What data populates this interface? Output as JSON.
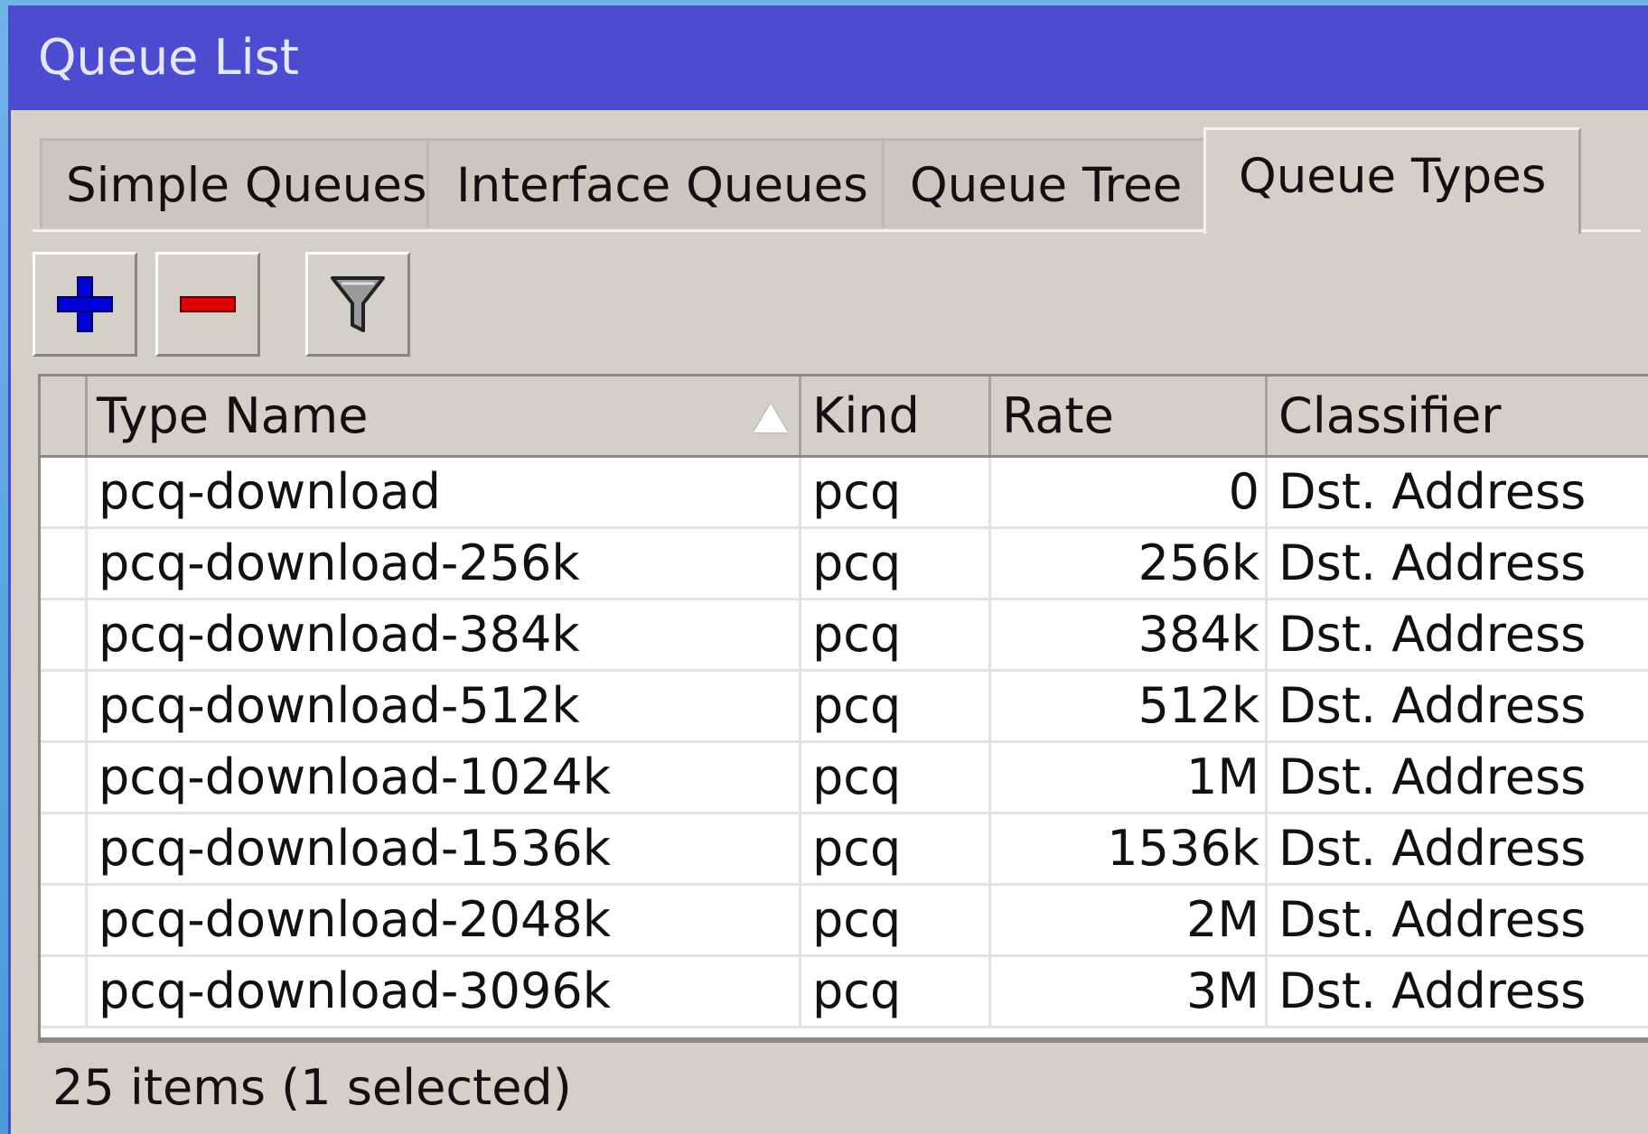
{
  "window": {
    "title": "Queue List",
    "accent": "#4b4ccf"
  },
  "tabs": [
    {
      "label": "Simple Queues",
      "active": false
    },
    {
      "label": "Interface Queues",
      "active": false
    },
    {
      "label": "Queue Tree",
      "active": false
    },
    {
      "label": "Queue Types",
      "active": true
    }
  ],
  "toolbar": {
    "add_icon": "plus-icon",
    "remove_icon": "minus-icon",
    "filter_icon": "funnel-icon",
    "add_color": "#0000d8",
    "remove_color": "#e00000"
  },
  "table": {
    "columns": [
      "Type Name",
      "Kind",
      "Rate",
      "Classifier"
    ],
    "sort_column": "Type Name",
    "sort_icon": "sort-asc-icon",
    "rows": [
      {
        "type_name": "pcq-download",
        "kind": "pcq",
        "rate": "0",
        "classifier": "Dst. Address"
      },
      {
        "type_name": "pcq-download-256k",
        "kind": "pcq",
        "rate": "256k",
        "classifier": "Dst. Address"
      },
      {
        "type_name": "pcq-download-384k",
        "kind": "pcq",
        "rate": "384k",
        "classifier": "Dst. Address"
      },
      {
        "type_name": "pcq-download-512k",
        "kind": "pcq",
        "rate": "512k",
        "classifier": "Dst. Address"
      },
      {
        "type_name": "pcq-download-1024k",
        "kind": "pcq",
        "rate": "1M",
        "classifier": "Dst. Address"
      },
      {
        "type_name": "pcq-download-1536k",
        "kind": "pcq",
        "rate": "1536k",
        "classifier": "Dst. Address"
      },
      {
        "type_name": "pcq-download-2048k",
        "kind": "pcq",
        "rate": "2M",
        "classifier": "Dst. Address"
      },
      {
        "type_name": "pcq-download-3096k",
        "kind": "pcq",
        "rate": "3M",
        "classifier": "Dst. Address"
      }
    ]
  },
  "status": {
    "text": "25 items (1 selected)"
  }
}
